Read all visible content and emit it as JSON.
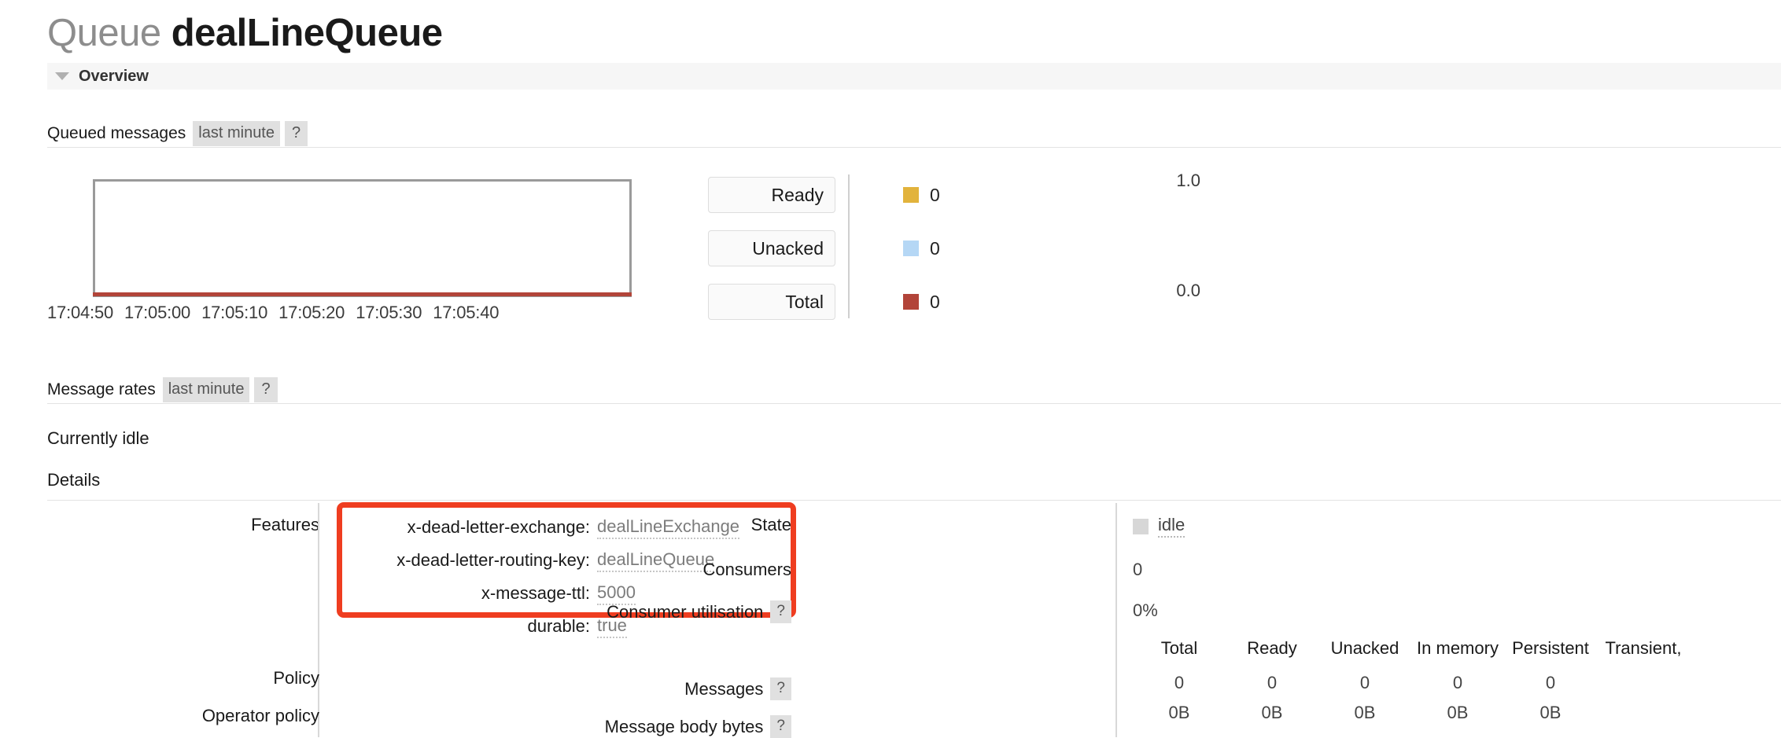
{
  "page": {
    "title_prefix": "Queue",
    "title_name": "dealLineQueue"
  },
  "overview_section": {
    "label": "Overview",
    "toggle_icon": "triangle-down-icon"
  },
  "queued_messages": {
    "title": "Queued messages",
    "period": "last minute",
    "help": "?"
  },
  "message_rates": {
    "title": "Message rates",
    "period": "last minute",
    "help": "?",
    "status": "Currently idle"
  },
  "details": {
    "label": "Details",
    "features_label": "Features",
    "policy_label": "Policy",
    "operator_policy_label": "Operator policy",
    "features": [
      {
        "key": "x-dead-letter-exchange:",
        "value": "dealLineExchange",
        "highlighted": true
      },
      {
        "key": "x-dead-letter-routing-key:",
        "value": "dealLineQueue",
        "highlighted": true
      },
      {
        "key": "x-message-ttl:",
        "value": "5000",
        "highlighted": true
      },
      {
        "key": "durable:",
        "value": "true",
        "highlighted": false
      }
    ],
    "state_label": "State",
    "state_value": "idle",
    "consumers_label": "Consumers",
    "consumers_value": "0",
    "consumer_utilisation_label": "Consumer utilisation",
    "consumer_utilisation_help": "?",
    "consumer_utilisation_value": "0%",
    "stats": {
      "columns": [
        "Total",
        "Ready",
        "Unacked",
        "In memory",
        "Persistent",
        "Transient,"
      ],
      "rows": [
        {
          "label": "Messages",
          "help": "?",
          "values": [
            "0",
            "0",
            "0",
            "0",
            "0",
            ""
          ]
        },
        {
          "label": "Message body bytes",
          "help": "?",
          "values": [
            "0B",
            "0B",
            "0B",
            "0B",
            "0B",
            ""
          ]
        }
      ]
    }
  },
  "colors": {
    "ready": "#e2b33c",
    "unacked": "#b5d7f5",
    "total": "#b24439",
    "highlight": "#ef3d20",
    "idle_swatch": "#d7d7d7"
  },
  "chart_data": {
    "type": "line",
    "title": "Queued messages",
    "xlabel": "",
    "ylabel": "",
    "ylim": [
      0.0,
      1.0
    ],
    "yticks": [
      "1.0",
      "0.0"
    ],
    "x": [
      "17:04:50",
      "17:05:00",
      "17:05:10",
      "17:05:20",
      "17:05:30",
      "17:05:40"
    ],
    "grid": false,
    "legend_position": "right",
    "series": [
      {
        "name": "Ready",
        "color": "#e2b33c",
        "current": "0",
        "values": [
          0,
          0,
          0,
          0,
          0,
          0
        ]
      },
      {
        "name": "Unacked",
        "color": "#b5d7f5",
        "current": "0",
        "values": [
          0,
          0,
          0,
          0,
          0,
          0
        ]
      },
      {
        "name": "Total",
        "color": "#b24439",
        "current": "0",
        "values": [
          0,
          0,
          0,
          0,
          0,
          0
        ]
      }
    ]
  }
}
